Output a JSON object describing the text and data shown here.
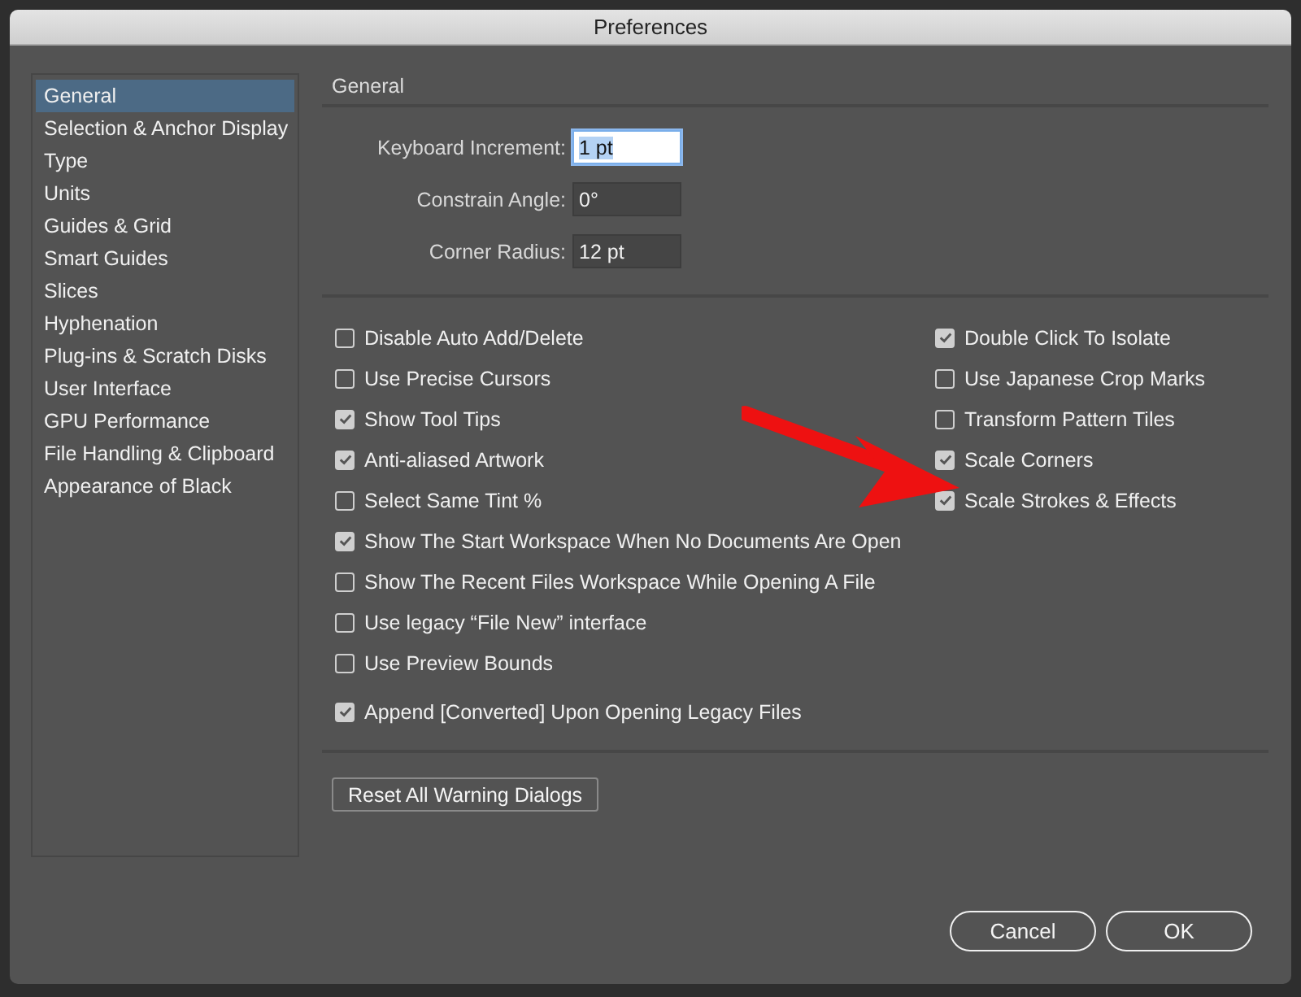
{
  "window": {
    "title": "Preferences"
  },
  "sidebar": {
    "items": [
      {
        "label": "General",
        "selected": true
      },
      {
        "label": "Selection & Anchor Display",
        "selected": false
      },
      {
        "label": "Type",
        "selected": false
      },
      {
        "label": "Units",
        "selected": false
      },
      {
        "label": "Guides & Grid",
        "selected": false
      },
      {
        "label": "Smart Guides",
        "selected": false
      },
      {
        "label": "Slices",
        "selected": false
      },
      {
        "label": "Hyphenation",
        "selected": false
      },
      {
        "label": "Plug-ins & Scratch Disks",
        "selected": false
      },
      {
        "label": "User Interface",
        "selected": false
      },
      {
        "label": "GPU Performance",
        "selected": false
      },
      {
        "label": "File Handling & Clipboard",
        "selected": false
      },
      {
        "label": "Appearance of Black",
        "selected": false
      }
    ]
  },
  "section_title": "General",
  "fields": [
    {
      "label": "Keyboard Increment:",
      "value": "1 pt",
      "focused": true
    },
    {
      "label": "Constrain Angle:",
      "value": "0°",
      "focused": false
    },
    {
      "label": "Corner Radius:",
      "value": "12 pt",
      "focused": false
    }
  ],
  "options_left": [
    {
      "label": "Disable Auto Add/Delete",
      "checked": false
    },
    {
      "label": "Use Precise Cursors",
      "checked": false
    },
    {
      "label": "Show Tool Tips",
      "checked": true
    },
    {
      "label": "Anti-aliased Artwork",
      "checked": true
    },
    {
      "label": "Select Same Tint %",
      "checked": false
    },
    {
      "label": "Show The Start Workspace When No Documents Are Open",
      "checked": true
    },
    {
      "label": "Show The Recent Files Workspace While Opening A File",
      "checked": false
    },
    {
      "label": "Use legacy “File New” interface",
      "checked": false
    },
    {
      "label": "Use Preview Bounds",
      "checked": false
    },
    {
      "label": "Append [Converted] Upon Opening Legacy Files",
      "checked": true
    }
  ],
  "options_right": [
    {
      "label": "Double Click To Isolate",
      "checked": true
    },
    {
      "label": "Use Japanese Crop Marks",
      "checked": false
    },
    {
      "label": "Transform Pattern Tiles",
      "checked": false
    },
    {
      "label": "Scale Corners",
      "checked": true
    },
    {
      "label": "Scale Strokes & Effects",
      "checked": true
    }
  ],
  "reset_button": "Reset All Warning Dialogs",
  "buttons": [
    "Cancel",
    "OK"
  ]
}
